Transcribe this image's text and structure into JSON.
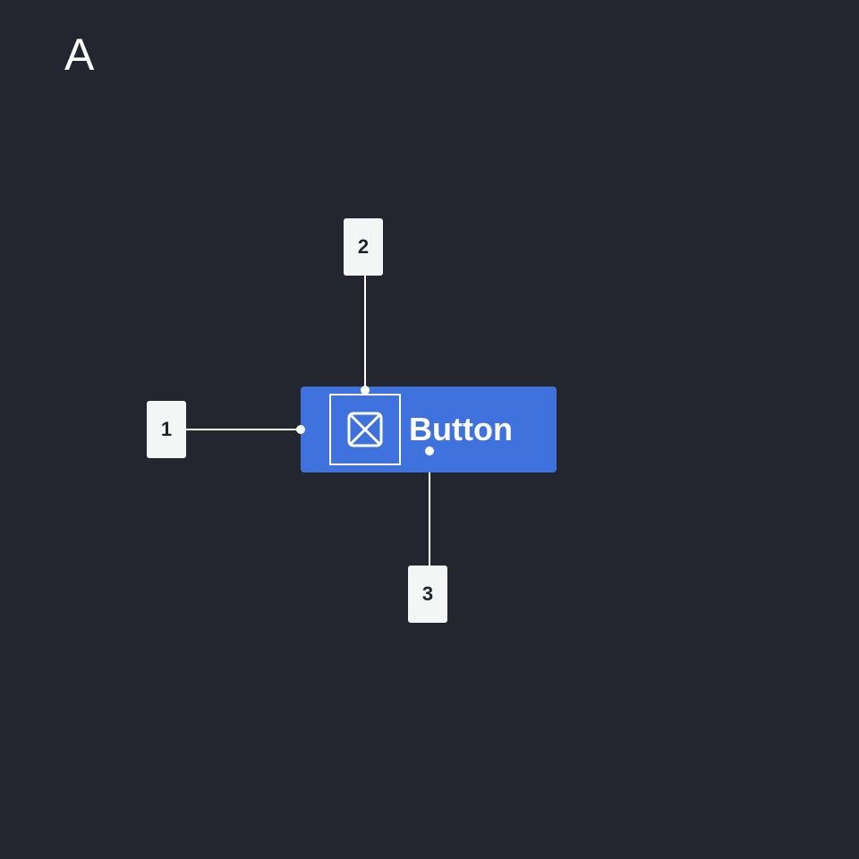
{
  "section": {
    "letter": "A"
  },
  "button": {
    "label": "Button",
    "icon": "placeholder-image-icon",
    "fill_color": "#3f72dc"
  },
  "callouts": [
    {
      "number": "1"
    },
    {
      "number": "2"
    },
    {
      "number": "3"
    }
  ],
  "colors": {
    "background": "#23262e",
    "leader_line": "#ffffff",
    "badge": "#f4f5f5"
  }
}
